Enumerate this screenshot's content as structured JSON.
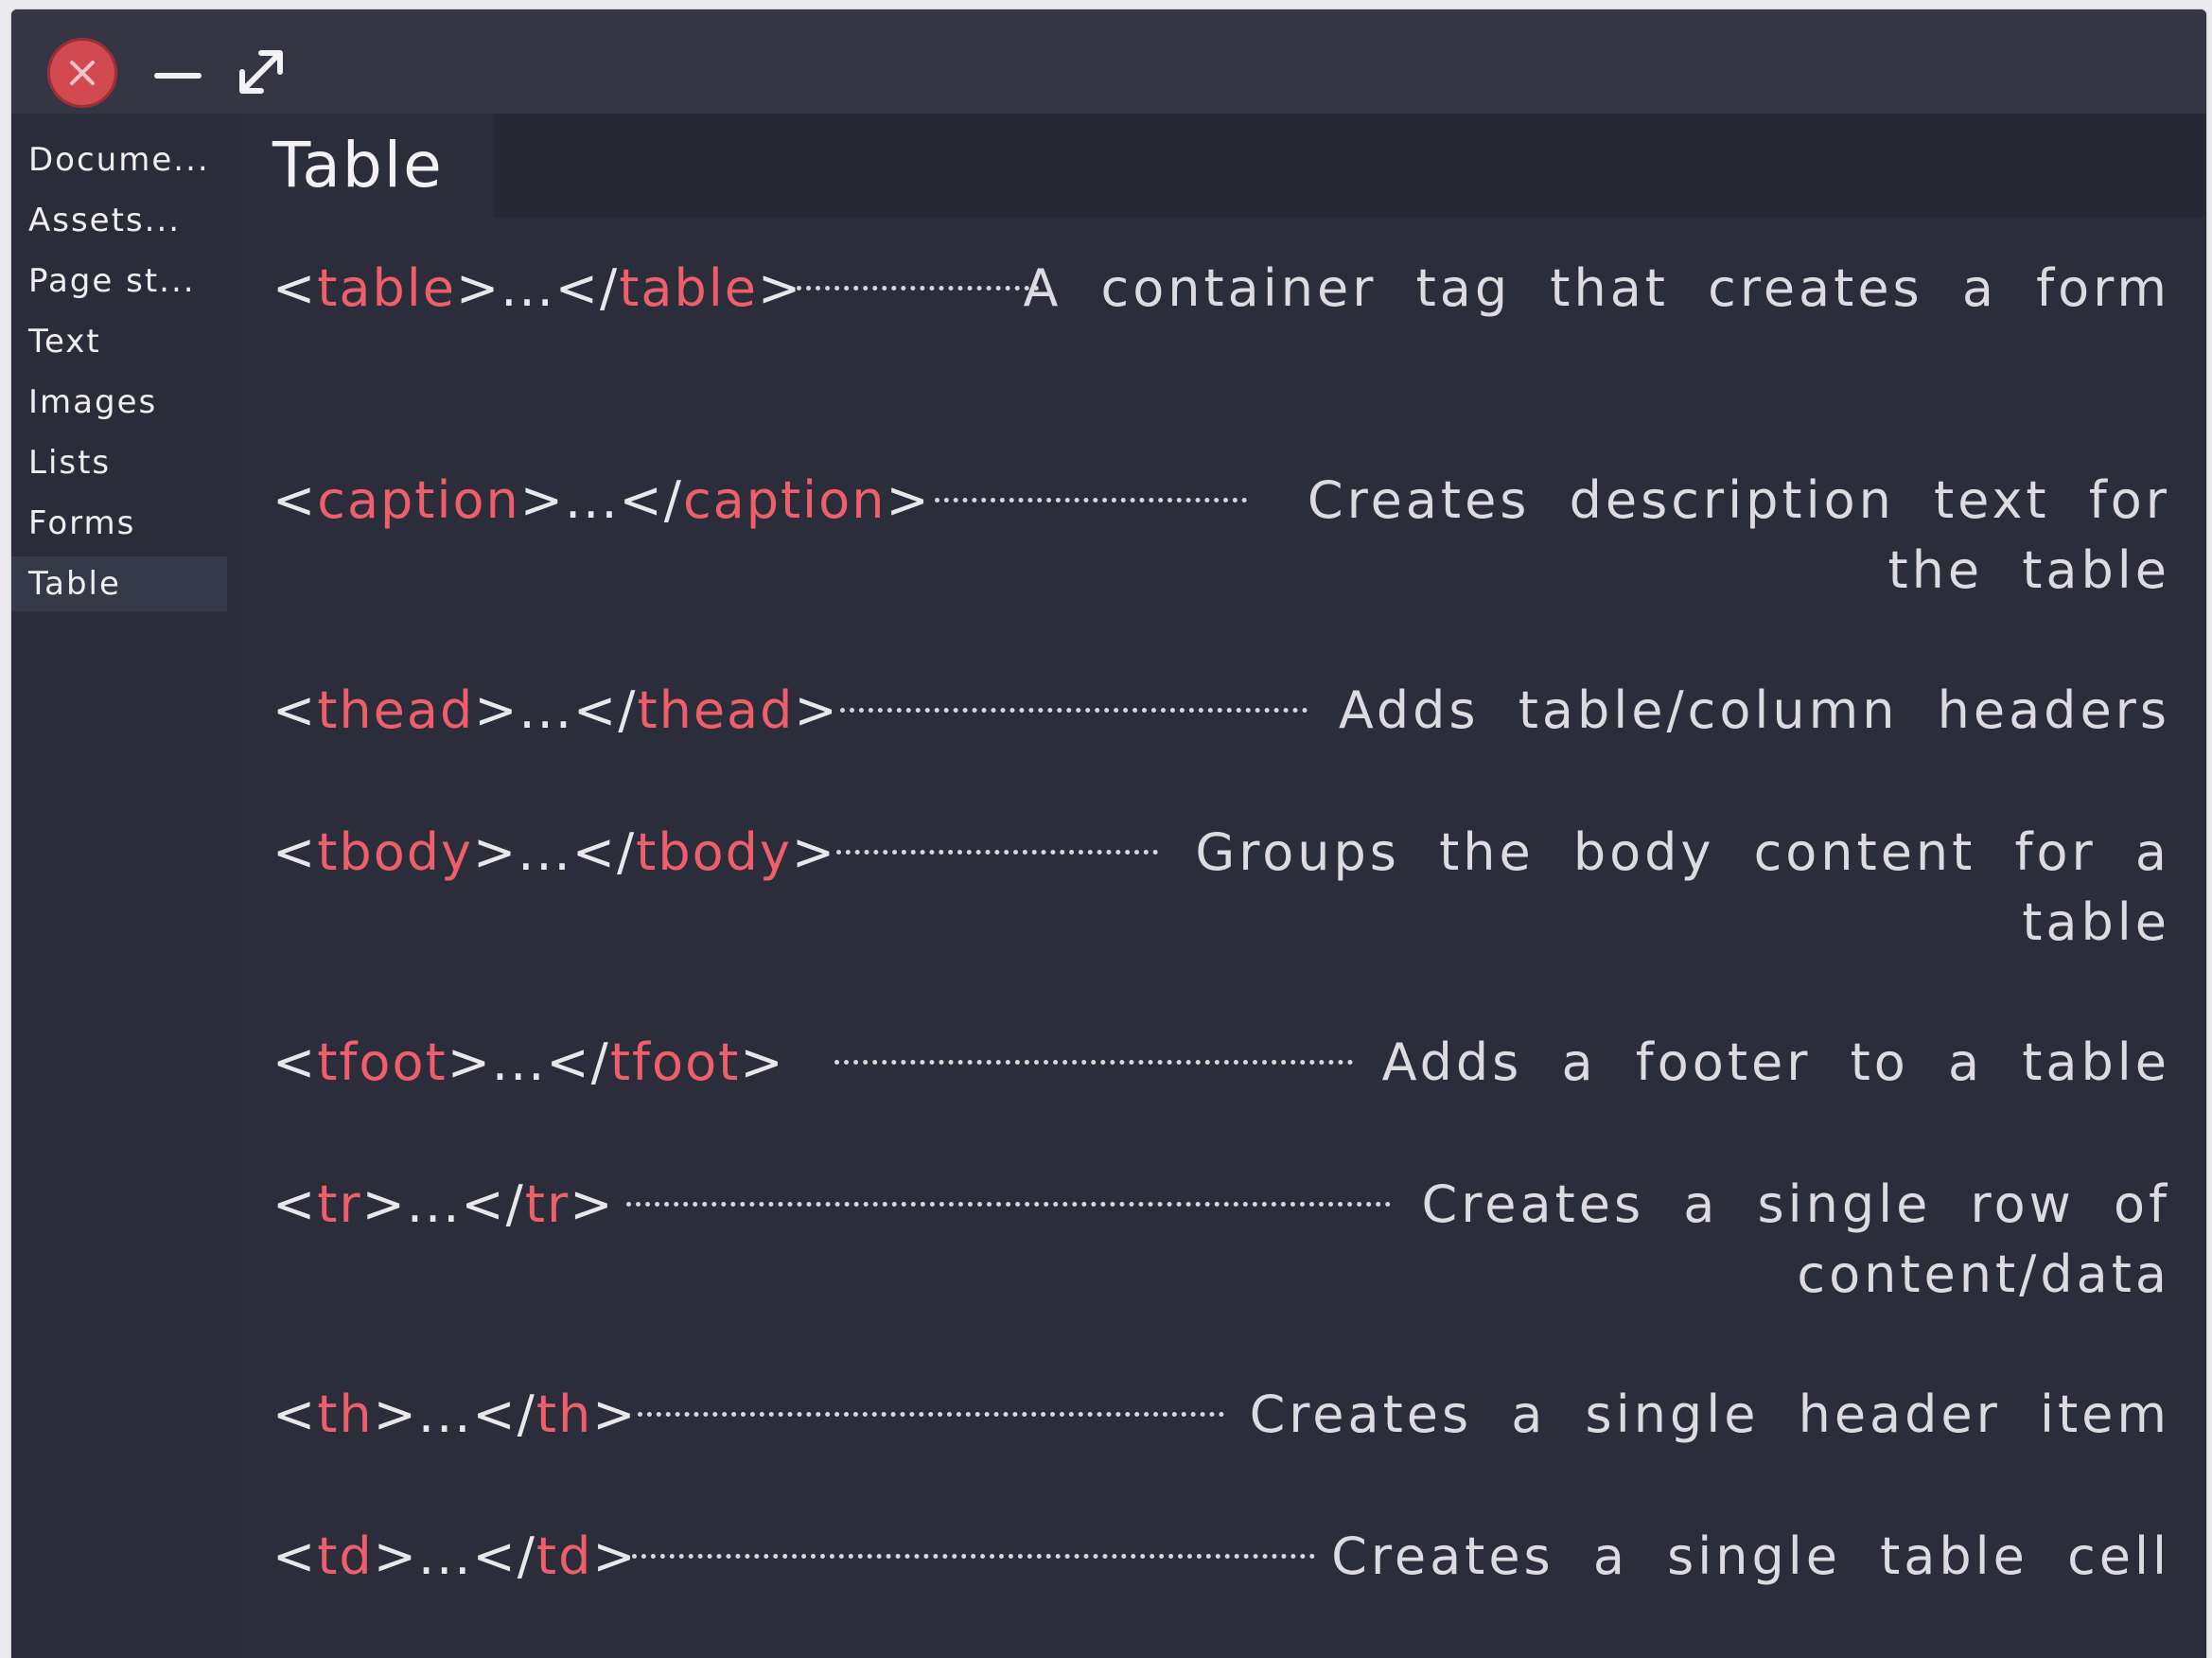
{
  "window": {
    "controls": {
      "close_icon": "close-icon",
      "minimize_icon": "minimize-icon",
      "maximize_icon": "expand-icon"
    }
  },
  "sidebar": {
    "items": [
      {
        "label": "Docume..."
      },
      {
        "label": "Assets..."
      },
      {
        "label": "Page st..."
      },
      {
        "label": "Text"
      },
      {
        "label": "Images"
      },
      {
        "label": "Lists"
      },
      {
        "label": "Forms"
      },
      {
        "label": "Table",
        "active": true
      }
    ]
  },
  "main": {
    "title": "Table",
    "rows": [
      {
        "open": "<",
        "name": "table",
        "mid": ">...</",
        "close": ">",
        "description": "A container tag that creates a form"
      },
      {
        "open": "<",
        "name": "caption",
        "mid": ">...</",
        "close": ">",
        "description": "Creates description text for the table"
      },
      {
        "open": "<",
        "name": "thead",
        "mid": ">...</",
        "close": ">",
        "description": "Adds table/column headers"
      },
      {
        "open": "<",
        "name": "tbody",
        "mid": ">...</",
        "close": ">",
        "description": "Groups the body content for a table"
      },
      {
        "open": "<",
        "name": "tfoot",
        "mid": ">...</",
        "close": ">",
        "description": "Adds a footer to a table"
      },
      {
        "open": "<",
        "name": "tr",
        "mid": ">...</",
        "close": ">",
        "description": "Creates a single row of content/data"
      },
      {
        "open": "<",
        "name": "th",
        "mid": ">...</",
        "close": ">",
        "description": "Creates a single header item"
      },
      {
        "open": "<",
        "name": "td",
        "mid": ">...</",
        "close": ">",
        "description": "Creates a single table cell"
      }
    ]
  },
  "colors": {
    "window_bg": "#2a2d39",
    "titlebar_bg": "#343644",
    "tag_keyword": "#ef5f6b",
    "close_button": "#d04a4f",
    "text": "#eae7ea"
  }
}
